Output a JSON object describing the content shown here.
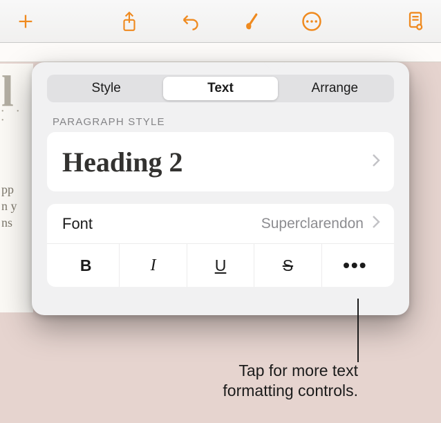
{
  "toolbar": {
    "add_icon": "plus-icon",
    "share_icon": "share-icon",
    "undo_icon": "undo-icon",
    "format_icon": "brush-icon",
    "more_icon": "more-icon",
    "doc_icon": "document-view-icon"
  },
  "popover": {
    "segments": {
      "style": "Style",
      "text": "Text",
      "arrange": "Arrange",
      "active": "text"
    },
    "paragraph_style_label": "PARAGRAPH STYLE",
    "paragraph_style_value": "Heading 2",
    "font_label": "Font",
    "font_value": "Superclarendon",
    "style_buttons": {
      "bold": "B",
      "italic": "I",
      "underline": "U",
      "strike": "S",
      "more": "•••"
    }
  },
  "callout": {
    "text_line1": "Tap for more text",
    "text_line2": "formatting controls."
  },
  "doc_fragment": {
    "big": "l",
    "dots": "• • •",
    "p1": "pp",
    "p2": "n y",
    "p3": "ns"
  }
}
